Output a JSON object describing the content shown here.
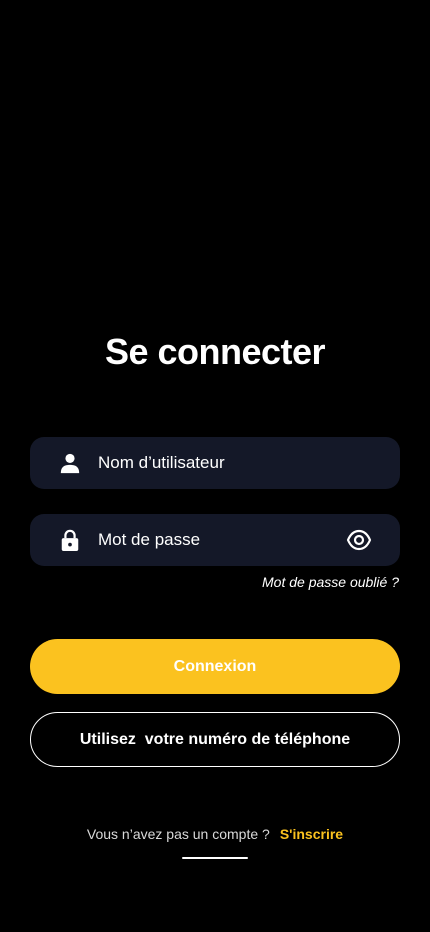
{
  "page": {
    "title": "Se connecter"
  },
  "form": {
    "username_placeholder": "Nom d’utilisateur",
    "username_value": "",
    "password_placeholder": "Mot de passe",
    "password_value": "",
    "forgot_password": "Mot de passe oublié ?"
  },
  "actions": {
    "login_label": "Connexion",
    "phone_label": "Utilisez  votre numéro de téléphone"
  },
  "signup": {
    "prompt": "Vous n’avez pas un compte ?",
    "link": "S'inscrire"
  },
  "icons": {
    "username": "user-icon",
    "password": "lock-icon",
    "toggle_visibility": "eye-icon"
  },
  "colors": {
    "background": "#000000",
    "field_background": "#141828",
    "accent": "#FBC21F",
    "text": "#ffffff"
  }
}
